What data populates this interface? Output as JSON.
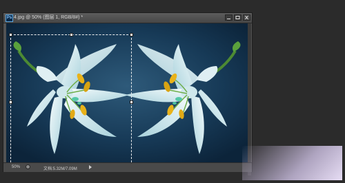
{
  "window": {
    "title": "4.jpg @ 50% (图层 1, RGB/8#) *",
    "logo_text": "Ps"
  },
  "status": {
    "zoom": "50%",
    "doc_size": "文档:5.32M/7.09M"
  },
  "colors": {
    "canvas_bg_center": "#2e5a7a",
    "canvas_bg_edge": "#0c243a",
    "petal": "#e8f6f8",
    "stamen": "#e9b21a",
    "stem": "#5a9c3a"
  }
}
